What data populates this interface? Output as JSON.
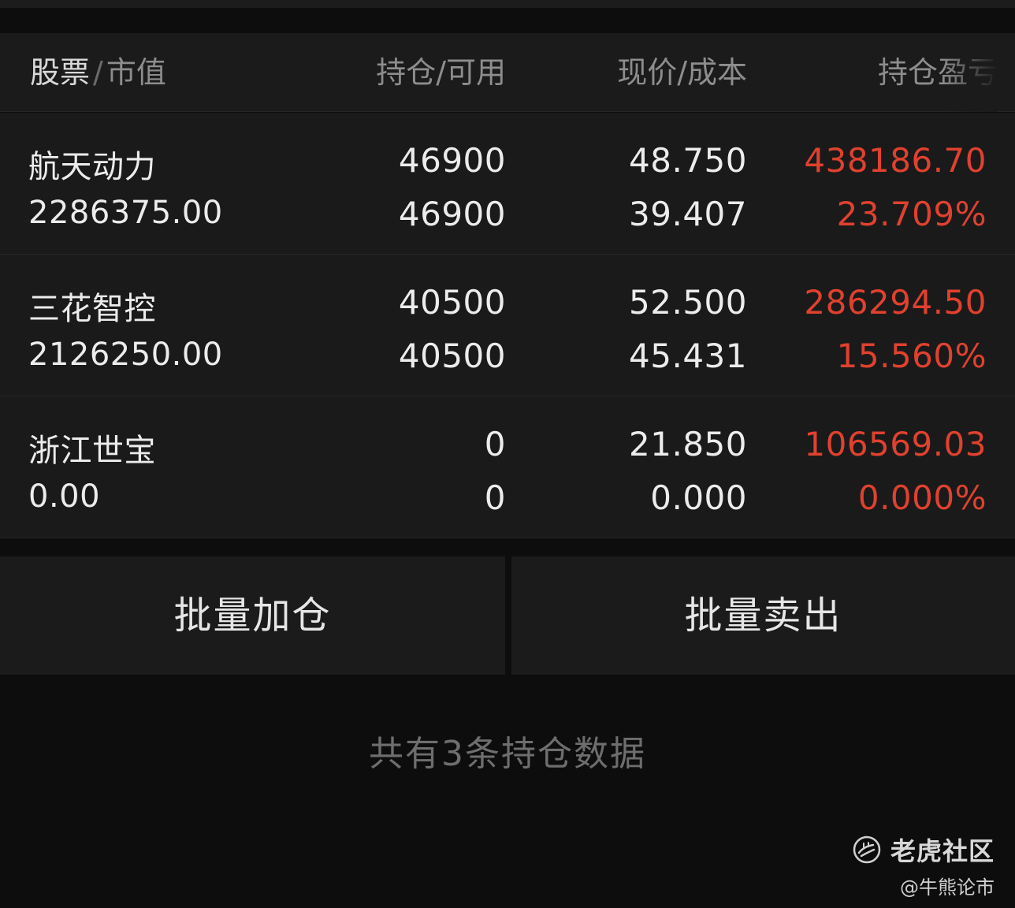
{
  "header": {
    "col1_primary": "股票",
    "col1_secondary": "市值",
    "col2": "持仓/可用",
    "col3": "现价/成本",
    "col4": "持仓盈亏",
    "separator": "/"
  },
  "positions": [
    {
      "name": "航天动力",
      "market_value": "2286375.00",
      "holding": "46900",
      "available": "46900",
      "price": "48.750",
      "cost": "39.407",
      "pnl": "438186.70",
      "pnl_pct": "23.709%"
    },
    {
      "name": "三花智控",
      "market_value": "2126250.00",
      "holding": "40500",
      "available": "40500",
      "price": "52.500",
      "cost": "45.431",
      "pnl": "286294.50",
      "pnl_pct": "15.560%"
    },
    {
      "name": "浙江世宝",
      "market_value": "0.00",
      "holding": "0",
      "available": "0",
      "price": "21.850",
      "cost": "0.000",
      "pnl": "106569.03",
      "pnl_pct": "0.000%"
    }
  ],
  "actions": {
    "batch_add": "批量加仓",
    "batch_sell": "批量卖出"
  },
  "summary": "共有3条持仓数据",
  "watermark": {
    "brand": "老虎社区",
    "author": "@牛熊论市"
  },
  "colors": {
    "profit": "#e0412f",
    "background": "#0d0d0d",
    "row_background": "#1a1a1a"
  }
}
